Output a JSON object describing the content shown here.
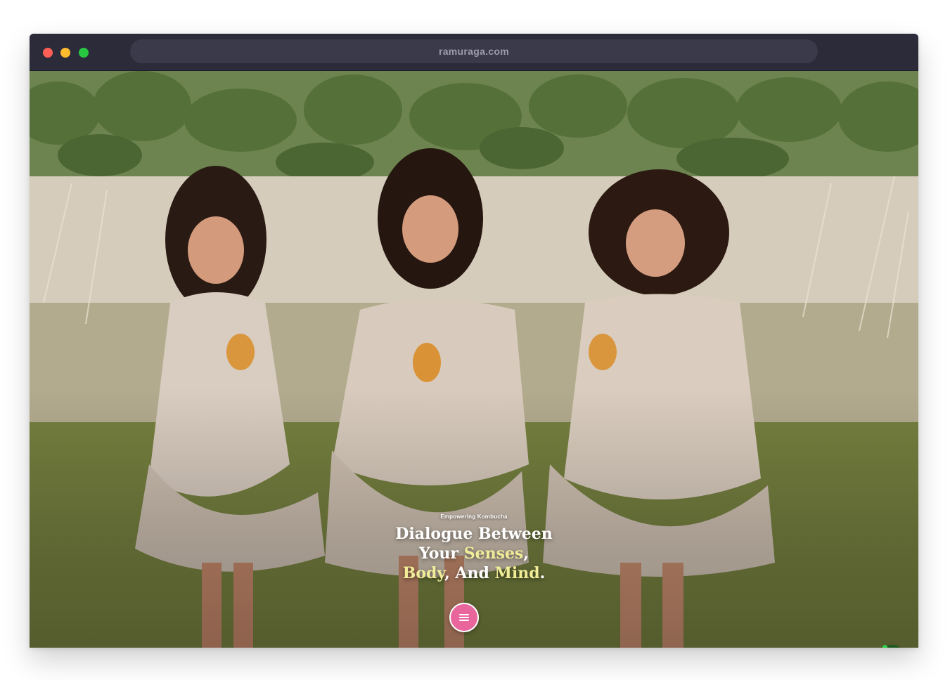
{
  "browser": {
    "url": "ramuraga.com"
  },
  "hero": {
    "eyebrow": "Empowering Kombucha",
    "headline": {
      "part1": "Dialogue Between",
      "part2": "Your ",
      "highlight1": "Senses",
      "part3": ",",
      "highlight2": "Body",
      "part4": ", And ",
      "highlight3": "Mind",
      "part5": "."
    },
    "image_description_icon": "hero-photo",
    "highlight_color": "#f1ec98"
  },
  "menu_button": {
    "icon": "hamburger-icon",
    "color": "#e8669b"
  },
  "whatsapp_button": {
    "icon": "whatsapp-icon",
    "color": "#1c5a1e",
    "status_color": "#2fd14b"
  }
}
